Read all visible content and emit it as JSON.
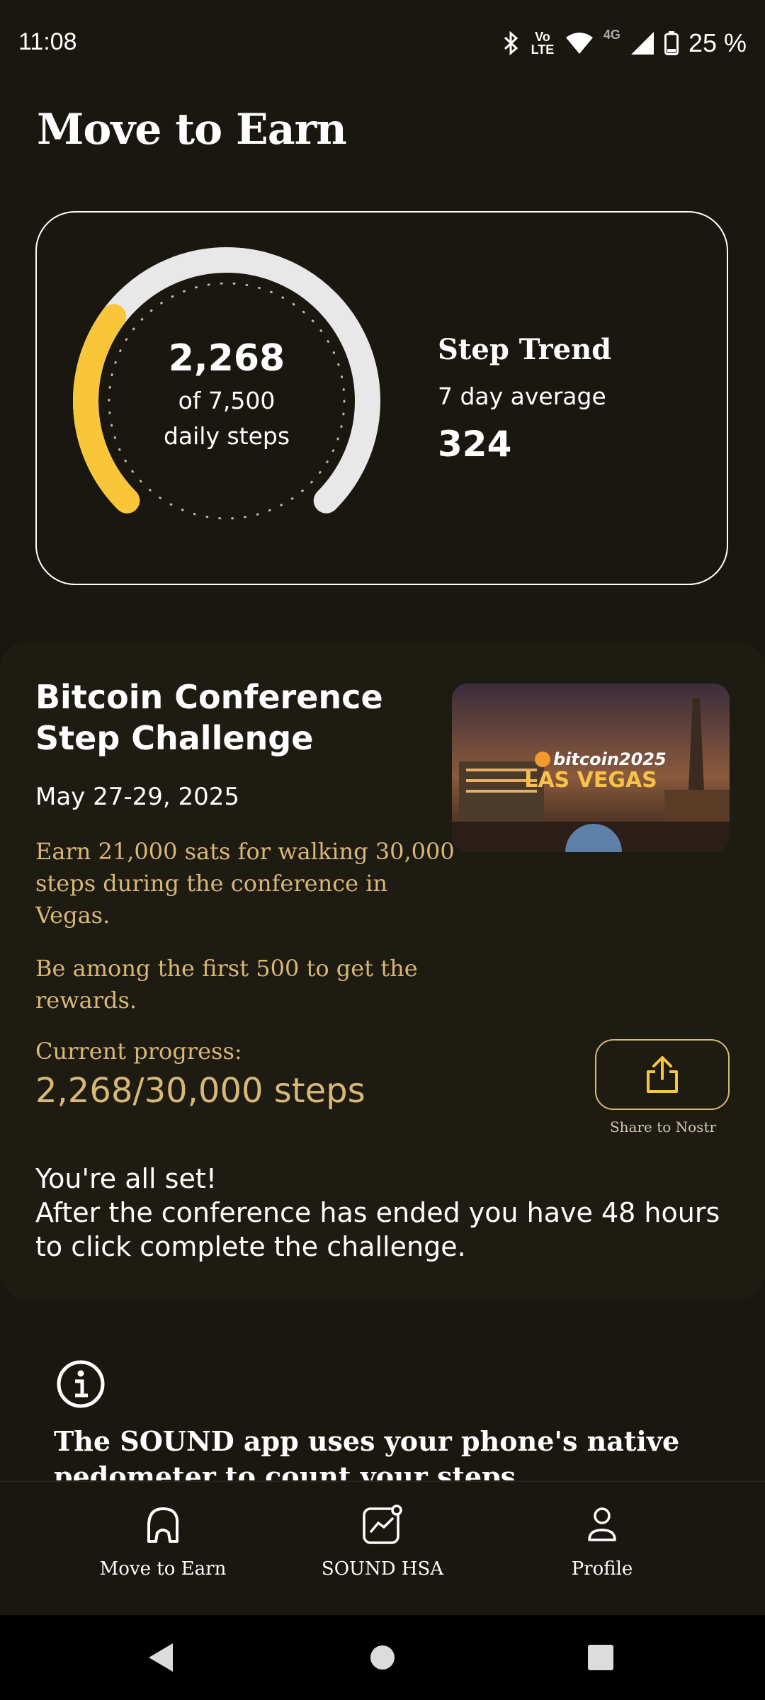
{
  "status_bar": {
    "time": "11:08",
    "icons": [
      "bluetooth-icon",
      "volte-icon",
      "wifi-icon",
      "4g-icon",
      "signal-icon",
      "battery-icon"
    ],
    "volte_label": "Vo LTE",
    "network_label": "4G",
    "battery": "25 %"
  },
  "page": {
    "title": "Move to Earn"
  },
  "steps_card": {
    "count": "2,268",
    "goal": "of 7,500",
    "unit": "daily steps",
    "progress_fraction": 0.3024,
    "trend_title": "Step Trend",
    "trend_subtitle": "7 day average",
    "trend_value": "324",
    "colors": {
      "progress": "#f9c63a",
      "track": "#e8e8e8"
    }
  },
  "challenge": {
    "title": "Bitcoin Conference Step Challenge",
    "image_text_top": "bitcoin2025",
    "image_text_bottom": "LAS VEGAS",
    "dates": "May 27-29, 2025",
    "description": "Earn 21,000 sats for walking 30,000 steps during the conference in Vegas.",
    "rule": "Be among the first 500 to get the rewards.",
    "progress_label": "Current progress:",
    "progress_value": "2,268/30,000 steps",
    "share_label": "Share to Nostr",
    "all_set": "You're all set!\nAfter the conference has ended you have 48 hours to click complete the challenge.",
    "accent": "#d9b876"
  },
  "info": {
    "text": "The SOUND app uses your phone's native pedometer to count your steps"
  },
  "bottom_nav": {
    "items": [
      {
        "label": "Move to Earn",
        "icon": "shoe-icon"
      },
      {
        "label": "SOUND HSA",
        "icon": "chart-icon"
      },
      {
        "label": "Profile",
        "icon": "profile-icon"
      }
    ]
  },
  "system_nav": {
    "buttons": [
      "back-icon",
      "home-icon",
      "recents-icon"
    ]
  }
}
